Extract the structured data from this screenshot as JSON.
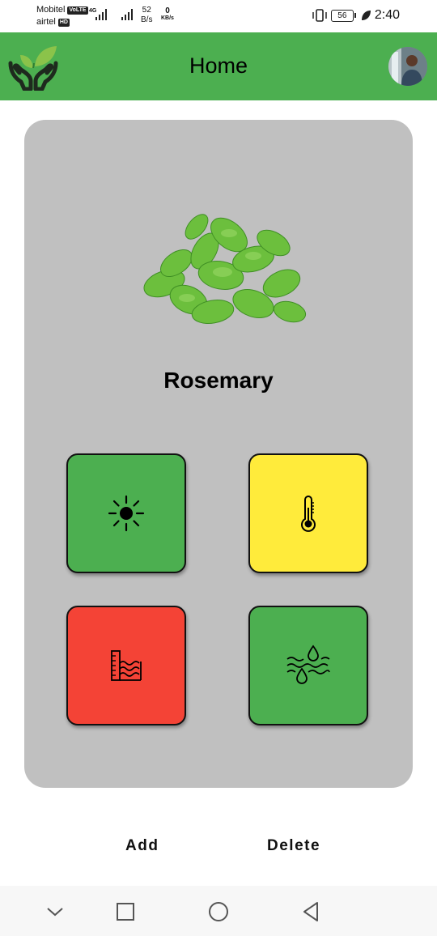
{
  "status_bar": {
    "carrier1": "Mobitel",
    "carrier1_badge": "VoLTE",
    "carrier2": "airtel",
    "carrier2_badge": "HD",
    "network": "4G",
    "speed_value": "52",
    "speed_unit": "B/s",
    "kbs_value": "0",
    "kbs_unit": "KB/s",
    "battery": "56",
    "time": "2:40"
  },
  "app_bar": {
    "title": "Home",
    "logo_icon": "plant-hands-icon",
    "avatar_icon": "user-avatar"
  },
  "card": {
    "plant_image": "oregano-leaves-image",
    "plant_name": "Rosemary",
    "tiles": [
      {
        "icon": "sun-icon",
        "color": "#4caf50"
      },
      {
        "icon": "thermometer-icon",
        "color": "#ffeb3b"
      },
      {
        "icon": "water-level-icon",
        "color": "#f44336"
      },
      {
        "icon": "humidity-icon",
        "color": "#4caf50"
      }
    ],
    "background": "#c0c0c0"
  },
  "actions": {
    "add_label": "Add",
    "delete_label": "Delete"
  },
  "nav_bar": {
    "items": [
      "chevron-down-icon",
      "recents-icon",
      "home-icon",
      "back-icon"
    ]
  },
  "colors": {
    "primary": "#4caf50",
    "warning": "#ffeb3b",
    "danger": "#f44336"
  }
}
